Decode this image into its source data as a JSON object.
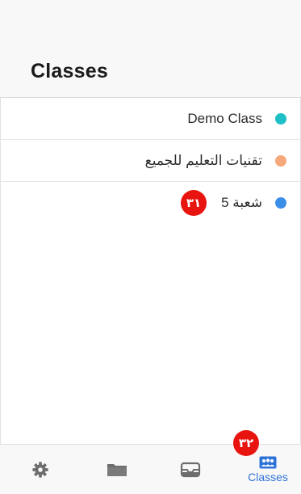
{
  "header": {
    "title": "Classes"
  },
  "classes": [
    {
      "name": "Demo Class",
      "color": "#1fbfc8",
      "badge": null
    },
    {
      "name": "تقنيات التعليم للجميع",
      "color": "#f5a97b",
      "badge": null
    },
    {
      "name": "شعبة 5",
      "color": "#3b8ee8",
      "badge": "٣١"
    }
  ],
  "tabbar": {
    "tabs": [
      {
        "icon": "gear-icon",
        "label": ""
      },
      {
        "icon": "folder-icon",
        "label": ""
      },
      {
        "icon": "inbox-tray-icon",
        "label": ""
      },
      {
        "icon": "people-icon",
        "label": "Classes",
        "active": true
      }
    ],
    "badge": "٣٢"
  },
  "colors": {
    "accent": "#2e73d8",
    "icon_inactive": "#6d6d6d",
    "badge": "#e8140f"
  }
}
